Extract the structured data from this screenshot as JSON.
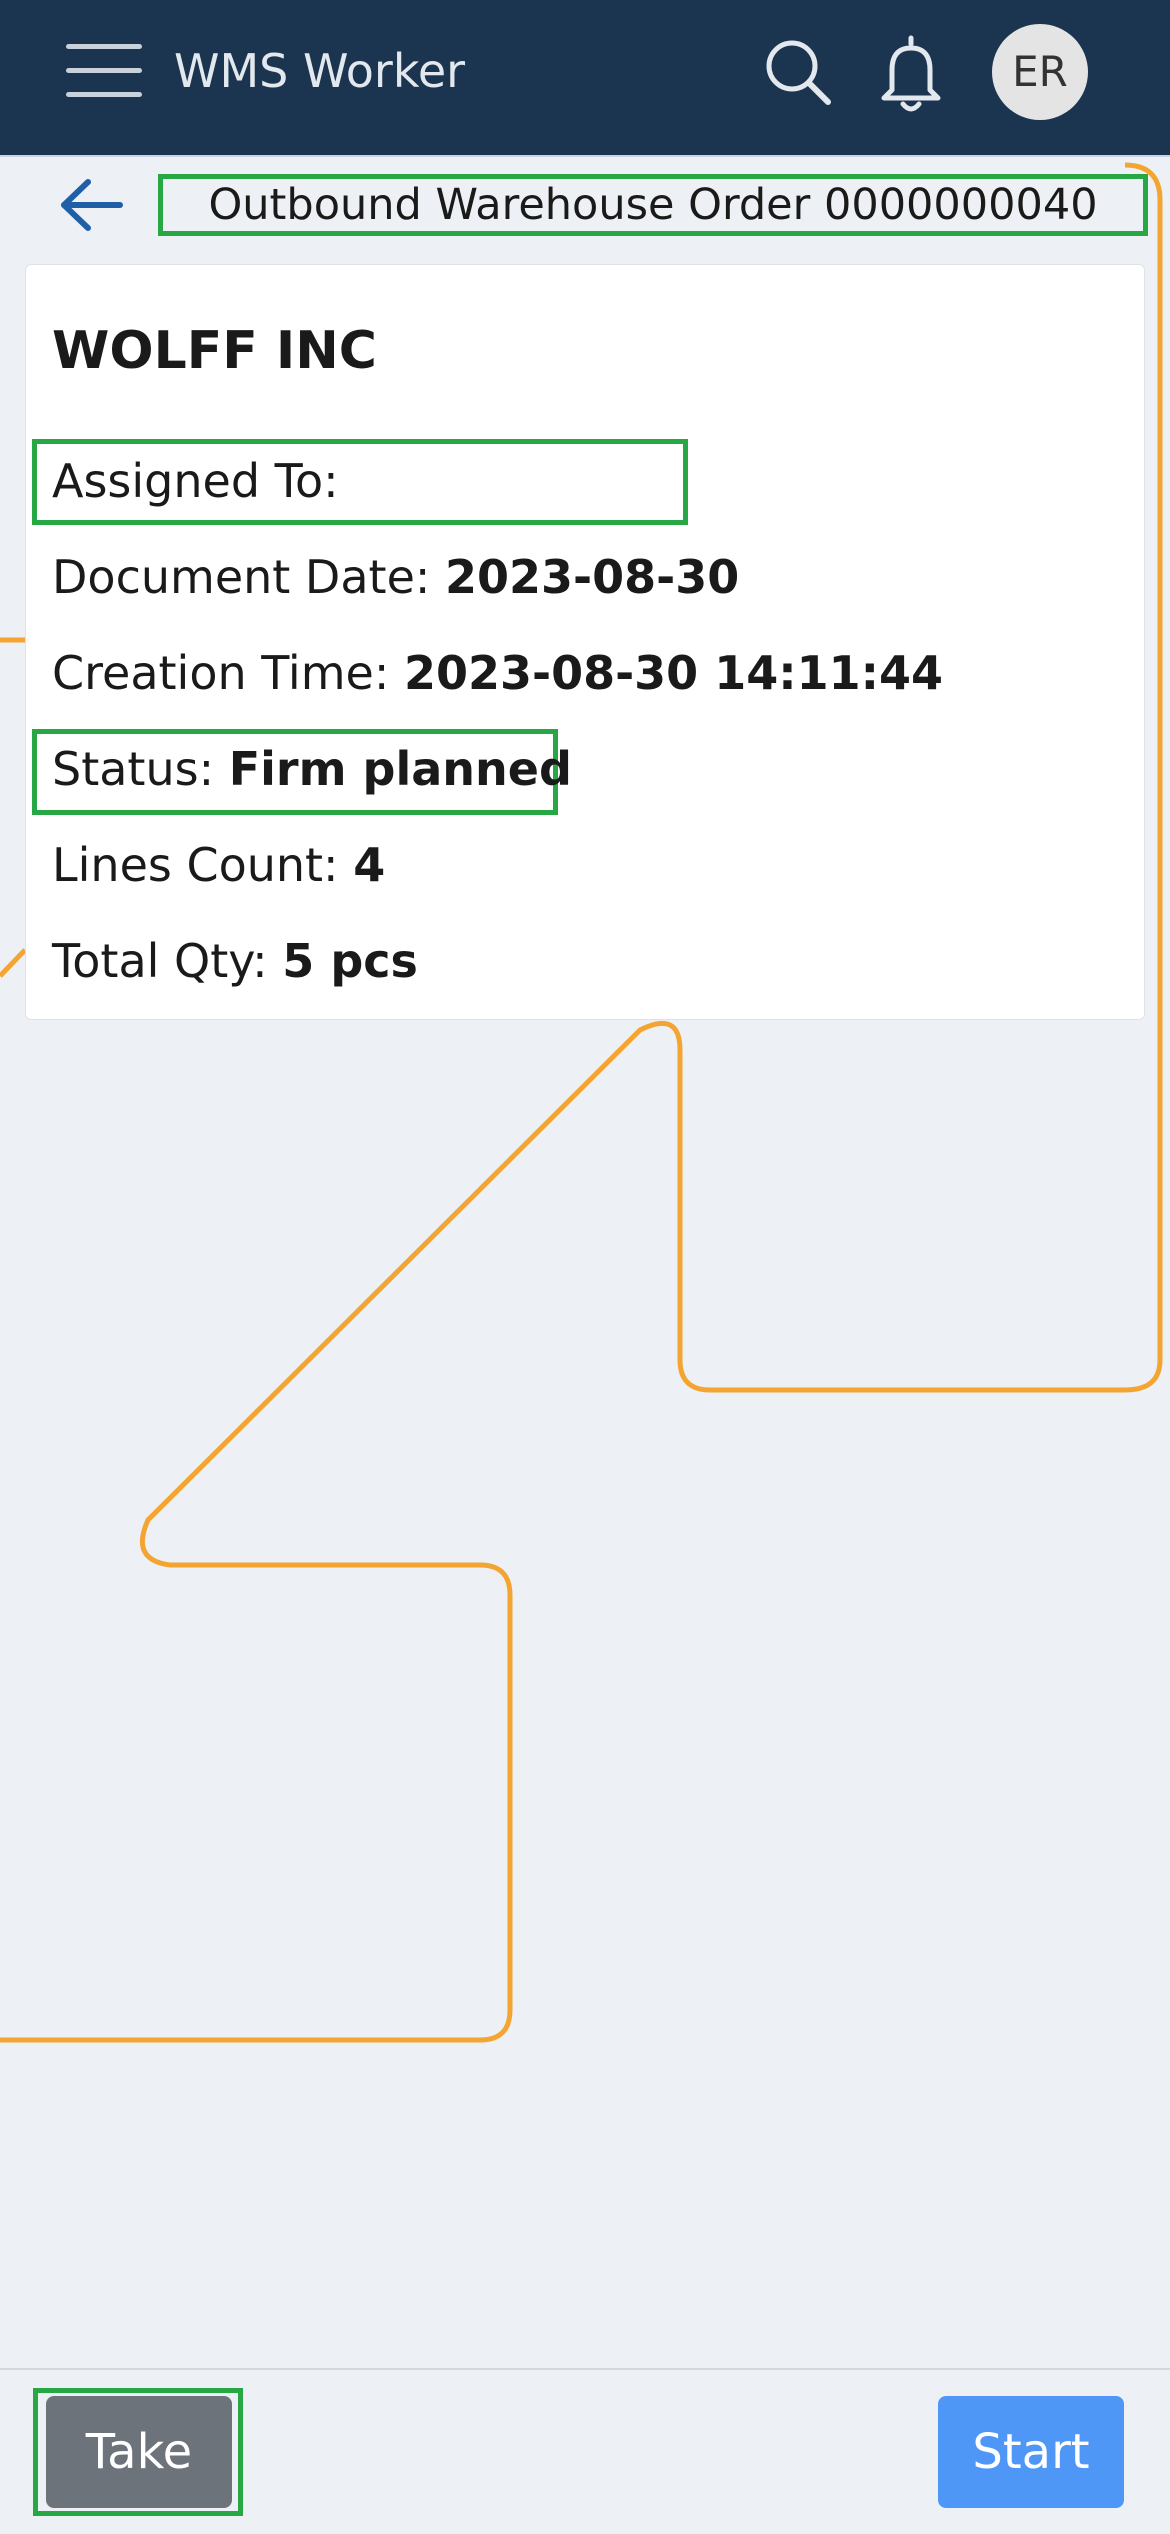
{
  "header": {
    "app_title": "WMS Worker",
    "avatar_initials": "ER",
    "menu_icon": "hamburger-menu-icon",
    "search_icon": "search-icon",
    "notification_icon": "bell-icon"
  },
  "page": {
    "back_icon": "arrow-left-icon",
    "title": "Outbound Warehouse Order 0000000040"
  },
  "order": {
    "customer": "WOLFF INC",
    "assigned_to_label": "Assigned To:",
    "assigned_to_value": "",
    "document_date_label": "Document Date:",
    "document_date_value": "2023-08-30",
    "creation_time_label": "Creation Time:",
    "creation_time_value": "2023-08-30 14:11:44",
    "status_label": "Status:",
    "status_value": "Firm planned",
    "lines_count_label": "Lines Count:",
    "lines_count_value": "4",
    "total_qty_label": "Total Qty:",
    "total_qty_value": "5 pcs"
  },
  "actions": {
    "take_label": "Take",
    "start_label": "Start"
  },
  "colors": {
    "header_bg": "#1b3550",
    "highlight": "#27a844",
    "overlay_path": "#f4a531",
    "take_bg": "#6d737b",
    "start_bg": "#4f97f7"
  }
}
